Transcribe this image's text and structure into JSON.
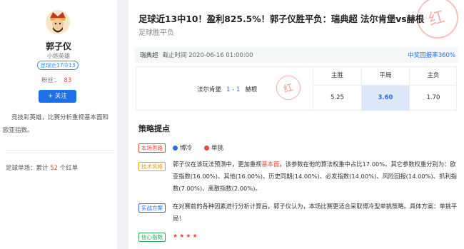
{
  "profile": {
    "name": "郭子仪",
    "title": "小炮英雄",
    "badge": "足球近17中13",
    "fans_label": "粉丝：",
    "fans_count": "83",
    "follow_label": "+ 关注",
    "bio": "竞技彩英雄，比赛分析重视基本面和欧亚指数。",
    "stat_prefix": "足球单场：累计",
    "stat_count": "52",
    "stat_suffix": "个红单"
  },
  "article": {
    "title": "足球近13中10！盈利825.5%！郭子仪胜平负：瑞典超 法尔肯堡vs赫根",
    "subtitle": "足球胜平负",
    "stamp": "红",
    "league": "瑞典超",
    "deadline": "截止时间 2020-06-16 01:00:00",
    "rate": "中奖回报率360%"
  },
  "odds_table": {
    "home": "法尔肯堡",
    "score": "1 - 1",
    "away": "赫根",
    "stamp": "红",
    "headers": [
      "主胜",
      "平局",
      "主负"
    ],
    "values": [
      "5.25",
      "3.60",
      "1.70"
    ],
    "selected_index": 1
  },
  "strategy": {
    "heading": "策略提点",
    "thought_tag": "本场思路",
    "options": [
      "博冷",
      "单挑"
    ],
    "option_colors": [
      "#1e6fe8",
      "#e64b3b"
    ],
    "tech_tag": "技术风格",
    "tech_p1": "郭子仪在该玩法预测中，更加重视",
    "tech_highlight": "基本面",
    "tech_p2": "，该参数在他的算法权重中占比17.00%。其它参数权重分别为：欧亚指数(16.00%)、其他(16.00%)、历史同期(14.00%)、必发指数(14.00%)、风险回报(14.00%)、抓利指数(7.00%)、离散指数(2.00%)。",
    "plan_tag": "实战方案",
    "plan_text": "在对赛前的各种因素进行分析计算后，郭子仪认为，本场比赛更适合采取博冷型单挑策略。具体方案：单挑平局！",
    "confidence_tag": "信心指数",
    "stars": "★★★★"
  }
}
